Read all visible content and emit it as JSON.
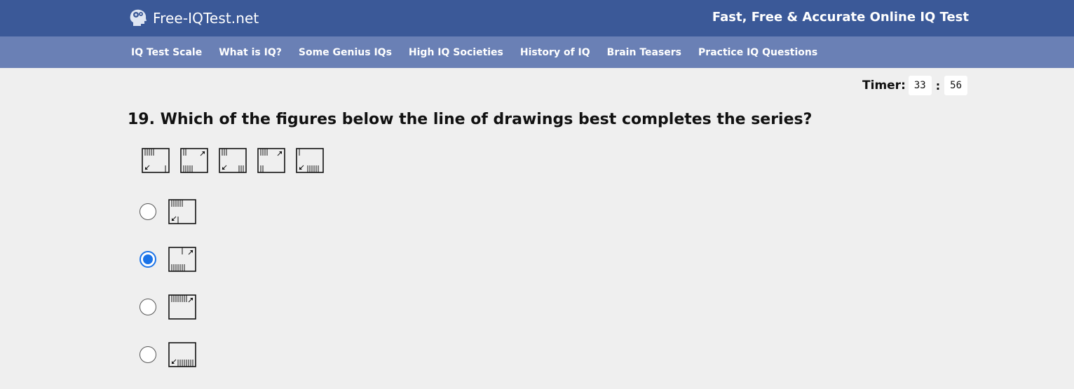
{
  "header": {
    "brand_name": "Free-IQTest.net",
    "logo_icon": "brain-gears-icon",
    "tagline": "Fast, Free & Accurate Online IQ Test"
  },
  "nav": {
    "items": [
      {
        "label": "IQ Test Scale"
      },
      {
        "label": "What is IQ?"
      },
      {
        "label": "Some Genius IQs"
      },
      {
        "label": "High IQ Societies"
      },
      {
        "label": "History of IQ"
      },
      {
        "label": "Brain Teasers"
      },
      {
        "label": "Practice IQ Questions"
      }
    ]
  },
  "timer": {
    "label": "Timer:",
    "minutes": "33",
    "separator": ":",
    "seconds": "56"
  },
  "question": {
    "text": "19. Which of the figures below the line of drawings best completes the series?",
    "series_figures": [
      "series-figure-1",
      "series-figure-2",
      "series-figure-3",
      "series-figure-4",
      "series-figure-5"
    ],
    "options": [
      {
        "name": "option-a",
        "selected": false
      },
      {
        "name": "option-b",
        "selected": true
      },
      {
        "name": "option-c",
        "selected": false
      },
      {
        "name": "option-d",
        "selected": false
      }
    ]
  },
  "colors": {
    "header_bg": "#3b5998",
    "nav_bg": "#6a80b5",
    "page_bg": "#efefef",
    "radio_selected": "#1a73e8"
  }
}
